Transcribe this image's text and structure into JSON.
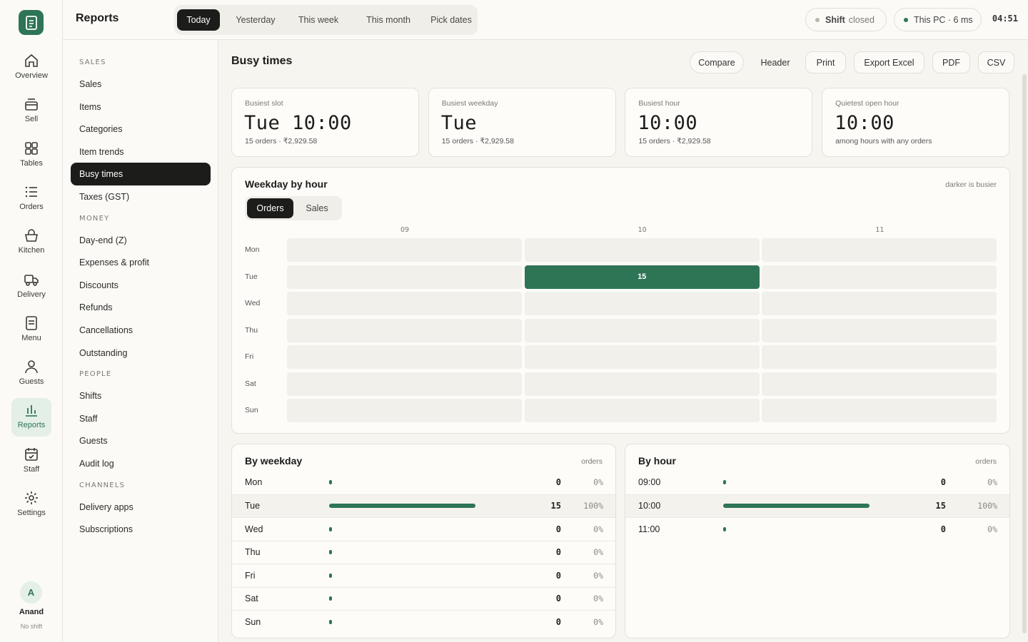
{
  "app": {
    "title": "Reports"
  },
  "rail": {
    "items": [
      {
        "label": "Overview",
        "icon": "home-icon"
      },
      {
        "label": "Sell",
        "icon": "register-icon"
      },
      {
        "label": "Tables",
        "icon": "grid-icon"
      },
      {
        "label": "Orders",
        "icon": "list-icon"
      },
      {
        "label": "Kitchen",
        "icon": "pot-icon"
      },
      {
        "label": "Delivery",
        "icon": "truck-icon"
      },
      {
        "label": "Menu",
        "icon": "menu-icon"
      },
      {
        "label": "Guests",
        "icon": "person-icon"
      },
      {
        "label": "Reports",
        "icon": "chart-icon",
        "active": true
      },
      {
        "label": "Staff",
        "icon": "calendar-icon"
      },
      {
        "label": "Settings",
        "icon": "gear-icon"
      }
    ],
    "user": {
      "initial": "A",
      "name": "Anand",
      "status": "No shift"
    }
  },
  "topbar": {
    "ranges": [
      "Today",
      "Yesterday",
      "This week",
      "This month",
      "Pick dates"
    ],
    "active_range": "Today",
    "shift": {
      "label": "Shift",
      "state": "closed"
    },
    "device": {
      "label": "This PC · 6 ms",
      "status_color": "#2e7555"
    },
    "clock": "04:51"
  },
  "sidebar": {
    "groups": [
      {
        "title": "SALES",
        "items": [
          "Sales",
          "Items",
          "Categories",
          "Item trends",
          "Busy times",
          "Taxes (GST)"
        ]
      },
      {
        "title": "MONEY",
        "items": [
          "Day-end (Z)",
          "Expenses & profit",
          "Discounts",
          "Refunds",
          "Cancellations",
          "Outstanding"
        ]
      },
      {
        "title": "PEOPLE",
        "items": [
          "Shifts",
          "Staff",
          "Guests",
          "Audit log"
        ]
      },
      {
        "title": "CHANNELS",
        "items": [
          "Delivery apps",
          "Subscriptions"
        ]
      }
    ],
    "active": "Busy times"
  },
  "main": {
    "title": "Busy times",
    "actions": [
      "Compare",
      "Header",
      "Print",
      "Export Excel",
      "PDF",
      "CSV"
    ],
    "stats": [
      {
        "label": "Busiest slot",
        "value": "Tue 10:00",
        "sub": "15 orders · ₹2,929.58"
      },
      {
        "label": "Busiest weekday",
        "value": "Tue",
        "sub": "15 orders · ₹2,929.58"
      },
      {
        "label": "Busiest hour",
        "value": "10:00",
        "sub": "15 orders · ₹2,929.58"
      },
      {
        "label": "Quietest open hour",
        "value": "10:00",
        "sub": "among hours with any orders"
      }
    ],
    "heatmap": {
      "title": "Weekday by hour",
      "hint": "darker is busier",
      "toggle": [
        "Orders",
        "Sales"
      ],
      "active_toggle": "Orders",
      "accent": "#2e7555"
    },
    "by_weekday": {
      "title": "By weekday",
      "unit": "orders"
    },
    "by_hour": {
      "title": "By hour",
      "unit": "orders"
    }
  },
  "chart_data": [
    {
      "type": "heatmap",
      "title": "Weekday by hour",
      "x": [
        "09",
        "10",
        "11"
      ],
      "y": [
        "Mon",
        "Tue",
        "Wed",
        "Thu",
        "Fri",
        "Sat",
        "Sun"
      ],
      "values": [
        [
          0,
          0,
          0
        ],
        [
          0,
          15,
          0
        ],
        [
          0,
          0,
          0
        ],
        [
          0,
          0,
          0
        ],
        [
          0,
          0,
          0
        ],
        [
          0,
          0,
          0
        ],
        [
          0,
          0,
          0
        ]
      ]
    },
    {
      "type": "bar",
      "title": "By weekday",
      "categories": [
        "Mon",
        "Tue",
        "Wed",
        "Thu",
        "Fri",
        "Sat",
        "Sun"
      ],
      "values": [
        0,
        15,
        0,
        0,
        0,
        0,
        0
      ],
      "percent": [
        "0%",
        "100%",
        "0%",
        "0%",
        "0%",
        "0%",
        "0%"
      ]
    },
    {
      "type": "bar",
      "title": "By hour",
      "categories": [
        "09:00",
        "10:00",
        "11:00"
      ],
      "values": [
        0,
        15,
        0
      ],
      "percent": [
        "0%",
        "100%",
        "0%"
      ]
    }
  ]
}
